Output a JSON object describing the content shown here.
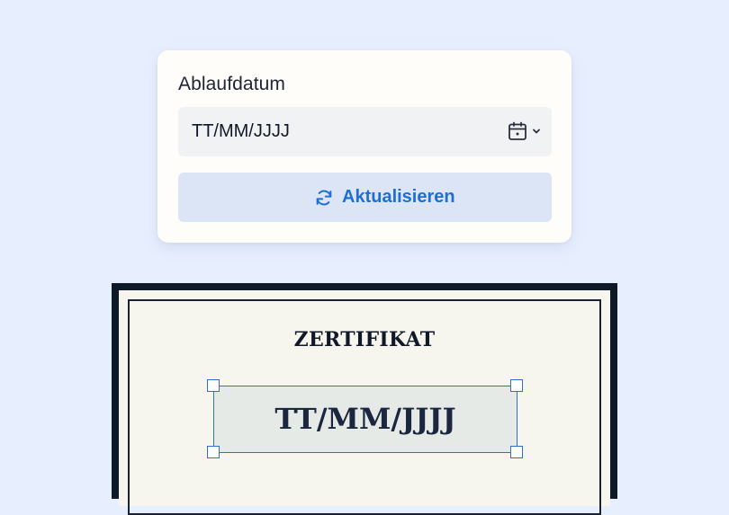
{
  "expiry_form": {
    "label": "Ablaufdatum",
    "date_value": "TT/MM/JJJJ",
    "refresh_button_label": "Aktualisieren",
    "icons": {
      "calendar": "calendar-icon",
      "dropdown": "chevron-down-icon",
      "refresh": "refresh-icon"
    }
  },
  "certificate": {
    "title": "ZERTIFIKAT",
    "date_placeholder": "TT/MM/JJJJ"
  },
  "colors": {
    "background": "#e7efff",
    "accent": "#1f6fd1",
    "button_bg": "#dbe5f6",
    "selection": "#2f6fd0",
    "certificate_frame": "#0f1a29",
    "certificate_paper": "#f6f6ee"
  }
}
